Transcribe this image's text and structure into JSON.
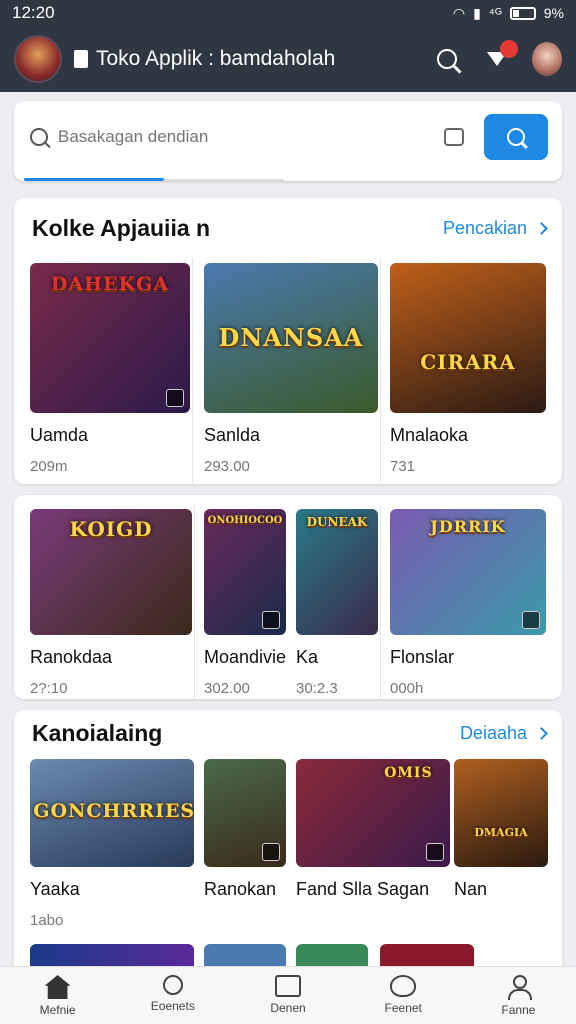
{
  "status": {
    "time": "12:20",
    "battery": "9%",
    "network": "⁴ᴳ"
  },
  "header": {
    "title": "Toko Applik : bamdaholah"
  },
  "search": {
    "placeholder": "Basakagan dendian"
  },
  "sections": [
    {
      "title": "Kolke Apjauiia n",
      "link": "Pencakian",
      "items": [
        {
          "name": "Uamda",
          "sub": "209m",
          "art": "DAHEKGA",
          "c1": "#7a2a4a",
          "c2": "#2a1a4a"
        },
        {
          "name": "Sanlda",
          "sub": "293.00",
          "art": "DNANSAA",
          "c1": "#3f6aa0",
          "c2": "#3a5a2a"
        },
        {
          "name": "Mnalaoka",
          "sub": "731",
          "art": "CIRARA",
          "c1": "#b0501a",
          "c2": "#2a1a14"
        }
      ]
    },
    {
      "title": "",
      "link": "",
      "items": [
        {
          "name": "Ranokdaa",
          "sub": "2?:10",
          "art": "KOIGD",
          "c1": "#6a3a7a",
          "c2": "#3a2a1a"
        },
        {
          "name": "Moandivie",
          "sub": "302.00",
          "art": "ONOHIOCOO",
          "c1": "#5a2a5a",
          "c2": "#1a2a4a"
        },
        {
          "name": "Ka",
          "sub": "30:2.3",
          "art": "DUNEAK",
          "c1": "#2a6a7a",
          "c2": "#3a2a4a"
        },
        {
          "name": "Flonslar",
          "sub": "000h",
          "art": "JDRRIK",
          "c1": "#6a4aa0",
          "c2": "#3a8a9a"
        }
      ]
    },
    {
      "title": "Kanoialaing",
      "link": "Deiaaha",
      "items": [
        {
          "name": "Yaaka",
          "sub": "1abo",
          "art": "GONCHRRIES",
          "c1": "#6a8ab0",
          "c2": "#2a3a5a"
        },
        {
          "name": "Ranokan",
          "sub": "",
          "art": "",
          "c1": "#4a6a4a",
          "c2": "#3a2a1a"
        },
        {
          "name": "Fand Slla Sagan",
          "sub": "",
          "art": "OMIS",
          "c1": "#8a2a3a",
          "c2": "#3a1a4a"
        },
        {
          "name": "Nan",
          "sub": "",
          "art": "DMAGIA",
          "c1": "#b06020",
          "c2": "#2a1a10"
        }
      ]
    }
  ],
  "nav": [
    {
      "label": "Mefnie"
    },
    {
      "label": "Eoenets"
    },
    {
      "label": "Denen"
    },
    {
      "label": "Feenet"
    },
    {
      "label": "Fanne"
    }
  ]
}
